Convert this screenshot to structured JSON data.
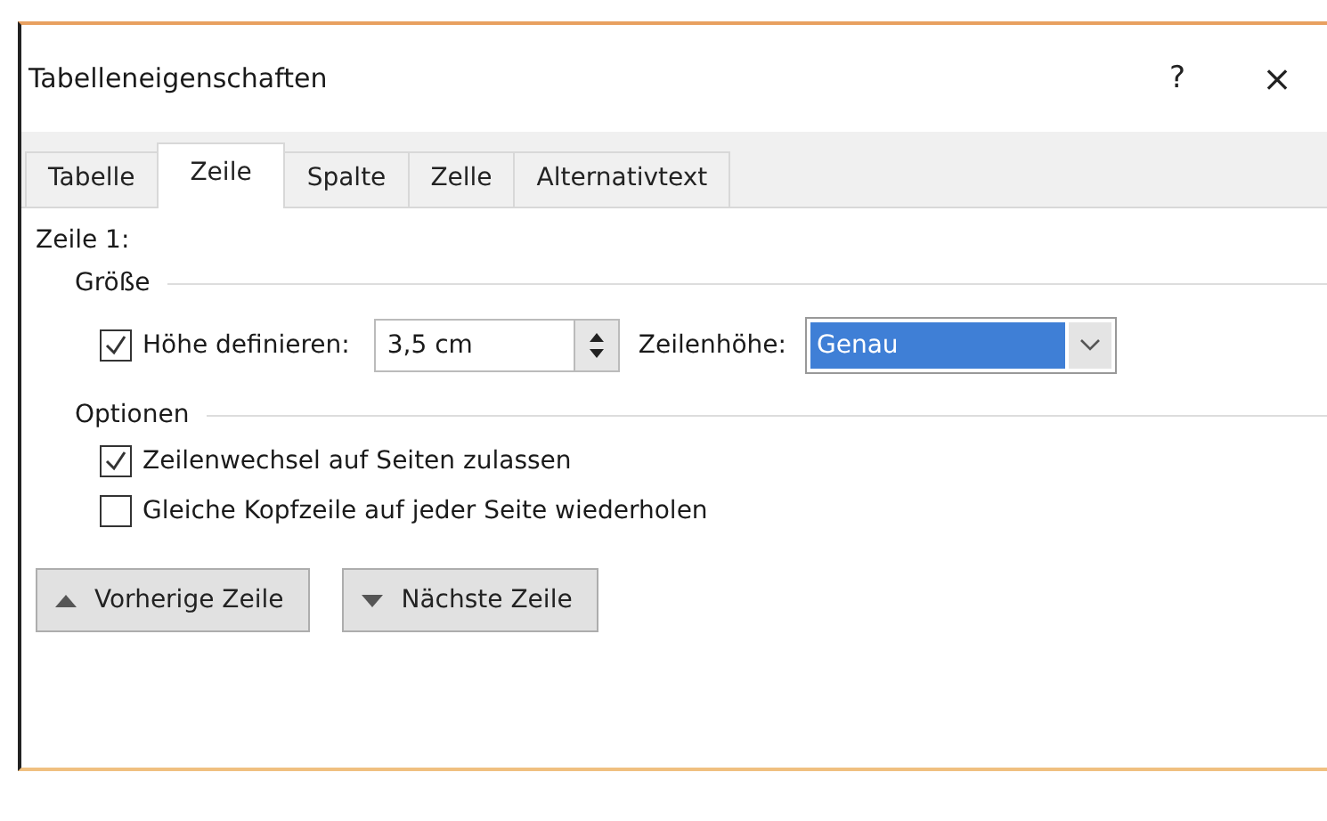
{
  "window": {
    "title": "Tabelleneigenschaften",
    "help": "?",
    "close": "×"
  },
  "tabs": [
    {
      "label": "Tabelle",
      "selected": false
    },
    {
      "label": "Zeile",
      "selected": true
    },
    {
      "label": "Spalte",
      "selected": false
    },
    {
      "label": "Zelle",
      "selected": false
    },
    {
      "label": "Alternativtext",
      "selected": false
    }
  ],
  "row_heading": "Zeile 1:",
  "size_group": {
    "title": "Größe",
    "define_height": {
      "label": "Höhe definieren:",
      "checked": true
    },
    "height_value": "3,5 cm",
    "row_height_label": "Zeilenhöhe:",
    "row_height_value": "Genau"
  },
  "options_group": {
    "title": "Optionen",
    "checkboxes": [
      {
        "label": "Zeilenwechsel auf Seiten zulassen",
        "checked": true
      },
      {
        "label": "Gleiche Kopfzeile auf jeder Seite wiederholen",
        "checked": false
      }
    ]
  },
  "buttons": [
    {
      "label": "Vorherige Zeile",
      "kind": "up"
    },
    {
      "label": "Nächste Zeile",
      "kind": "down"
    }
  ]
}
